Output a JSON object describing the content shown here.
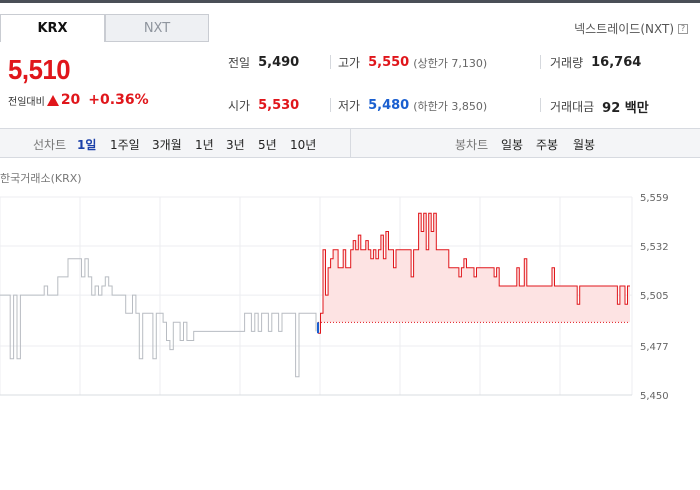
{
  "tabs": [
    {
      "label": "KRX",
      "active": true
    },
    {
      "label": "NXT",
      "active": false
    }
  ],
  "nxt_link": {
    "label": "넥스트레이드(NXT)",
    "icon": "help-icon",
    "icon_text": "?"
  },
  "price": {
    "current": "5,510",
    "change_label": "전일대비",
    "change_value": "20",
    "change_pct": "+0.36%",
    "direction": "up"
  },
  "stats": {
    "prev_close": {
      "label": "전일",
      "value": "5,490"
    },
    "open": {
      "label": "시가",
      "value": "5,530"
    },
    "high": {
      "label": "고가",
      "value": "5,550",
      "sub": "(상한가 7,130)"
    },
    "low": {
      "label": "저가",
      "value": "5,480",
      "sub": "(하한가 3,850)"
    },
    "volume": {
      "label": "거래량",
      "value": "16,764"
    },
    "amount": {
      "label": "거래대금",
      "value": "92 백만"
    }
  },
  "toolbar": {
    "line_label": "선차트",
    "line_periods": [
      "1일",
      "1주일",
      "3개월",
      "1년",
      "3년",
      "5년",
      "10년"
    ],
    "active_period": "1일",
    "candle_label": "봉차트",
    "candle_periods": [
      "일봉",
      "주봉",
      "월봉"
    ]
  },
  "colors": {
    "up": "#e0161b",
    "down": "#1a5fd0",
    "prev_day": "#b8bcc2",
    "fill": "#fde3e3"
  },
  "chart_title": "한국거래소(KRX)",
  "chart_data": {
    "type": "line",
    "ylim": [
      5450,
      5559
    ],
    "yticks": [
      "5,559",
      "5,532",
      "5,505",
      "5,477",
      "5,450"
    ],
    "ytick_values": [
      5559,
      5532,
      5505,
      5477,
      5450
    ],
    "baseline": 5490,
    "series": [
      {
        "values": [
          5505,
          5505,
          5505,
          5470,
          5505,
          5470,
          5505,
          5505,
          5505,
          5505,
          5505,
          5505,
          5505,
          5510,
          5505,
          5505,
          5505,
          5515,
          5515,
          5515,
          5525,
          5525,
          5525,
          5525,
          5515,
          5525,
          5515,
          5505,
          5510,
          5505,
          5510,
          5515,
          5510,
          5505,
          5505,
          5505,
          5505,
          5495,
          5495,
          5505,
          5495,
          5470,
          5495,
          5495,
          5495,
          5470,
          5495,
          5495,
          5490,
          5480,
          5475,
          5490,
          5490,
          5480,
          5490,
          5480,
          5480,
          5485,
          5485,
          5485,
          5485,
          5485,
          5485,
          5485,
          5485,
          5485,
          5485,
          5485,
          5485,
          5485,
          5485,
          5485,
          5495,
          5495,
          5485,
          5495,
          5485,
          5495,
          5495,
          5485,
          5495,
          5495,
          5485,
          5495,
          5495,
          5495,
          5495,
          5460,
          5495,
          5495,
          5495,
          5495,
          5495,
          5485
        ]
      },
      {
        "values": [
          5484,
          5495,
          5530,
          5505,
          5520,
          5525,
          5530,
          5530,
          5520,
          5520,
          5530,
          5520,
          5520,
          5530,
          5535,
          5530,
          5538,
          5530,
          5530,
          5535,
          5530,
          5525,
          5530,
          5525,
          5530,
          5538,
          5525,
          5540,
          5530,
          5530,
          5520,
          5530,
          5530,
          5530,
          5530,
          5530,
          5530,
          5515,
          5530,
          5530,
          5550,
          5540,
          5550,
          5530,
          5550,
          5540,
          5550,
          5530,
          5530,
          5530,
          5530,
          5530,
          5520,
          5520,
          5520,
          5520,
          5515,
          5520,
          5525,
          5520,
          5520,
          5520,
          5515,
          5520,
          5520,
          5520,
          5520,
          5520,
          5520,
          5520,
          5515,
          5520,
          5510,
          5510,
          5510,
          5510,
          5510,
          5510,
          5510,
          5520,
          5510,
          5510,
          5525,
          5510,
          5510,
          5510,
          5510,
          5510,
          5510,
          5510,
          5510,
          5510,
          5510,
          5520,
          5510,
          5510,
          5510,
          5510,
          5510,
          5510,
          5510,
          5510,
          5510,
          5500,
          5510,
          5510,
          5510,
          5510,
          5510,
          5510,
          5510,
          5510,
          5510,
          5510,
          5510,
          5510,
          5510,
          5510,
          5510,
          5500,
          5510,
          5510,
          5500,
          5510,
          5510
        ]
      }
    ]
  }
}
